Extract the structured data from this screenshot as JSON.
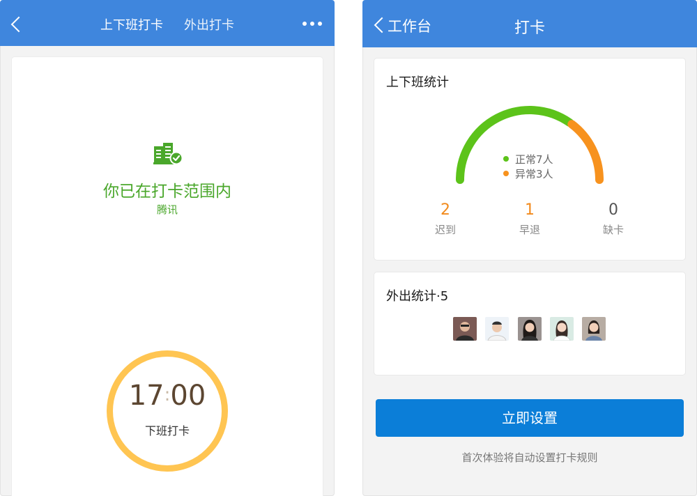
{
  "left_screen": {
    "tabs": [
      "上下班打卡",
      "外出打卡"
    ],
    "status_title": "你已在打卡范围内",
    "location": "腾讯",
    "clock": {
      "hour": "17",
      "minute": "00",
      "label": "下班打卡"
    }
  },
  "right_screen": {
    "back_label": "工作台",
    "title": "打卡",
    "attendance": {
      "title": "上下班统计",
      "normal_label": "正常7人",
      "abnormal_label": "异常3人",
      "normal_count": 7,
      "abnormal_count": 3,
      "stats": [
        {
          "value": "2",
          "label": "迟到",
          "color": "#f28a1c"
        },
        {
          "value": "1",
          "label": "早退",
          "color": "#f28a1c"
        },
        {
          "value": "0",
          "label": "缺卡",
          "color": "#555555"
        }
      ]
    },
    "outing": {
      "title": "外出统计·5"
    },
    "primary_button": "立即设置",
    "footnote": "首次体验将自动设置打卡规则"
  },
  "colors": {
    "nav_blue": "#3f86dd",
    "success_green": "#4aa72b",
    "gauge_green": "#5cc31a",
    "gauge_orange": "#f7921e",
    "clock_ring": "#ffc552",
    "button_blue": "#0b7ed8"
  },
  "icons": [
    "back-chevron-icon",
    "more-dots-icon",
    "building-check-icon"
  ]
}
